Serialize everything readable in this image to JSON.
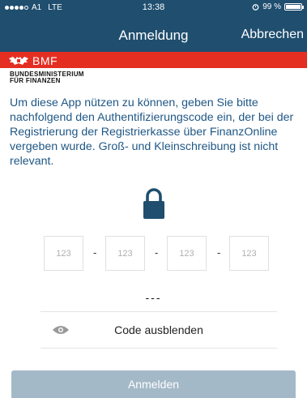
{
  "status_bar": {
    "carrier": "A1",
    "network": "LTE",
    "time": "13:38",
    "battery": "99 %",
    "battery_level": 0.99
  },
  "nav": {
    "title": "Anmeldung",
    "cancel_label": "Abbrechen"
  },
  "brand": {
    "logo_text": "BMF",
    "ministry_line1": "BUNDESMINISTERIUM",
    "ministry_line2": "FÜR FINANZEN",
    "accent": "#e52e22",
    "nav_color": "#1f4e6f"
  },
  "intro_text": "Um diese App nützen zu können, geben Sie bitte nachfolgend den Authentifizierungscode ein, der bei der Registrierung der Registrierkasse über FinanzOnline vergeben wurde. Groß- und Kleinschreibung ist nicht relevant.",
  "lock_icon": "lock-icon",
  "code_fields": [
    {
      "placeholder": "123"
    },
    {
      "placeholder": "123"
    },
    {
      "placeholder": "123"
    },
    {
      "placeholder": "123"
    }
  ],
  "separator": "-",
  "masked_code": "---",
  "toggle": {
    "icon": "eye-icon",
    "label": "Code ausblenden"
  },
  "login_label": "Anmelden"
}
